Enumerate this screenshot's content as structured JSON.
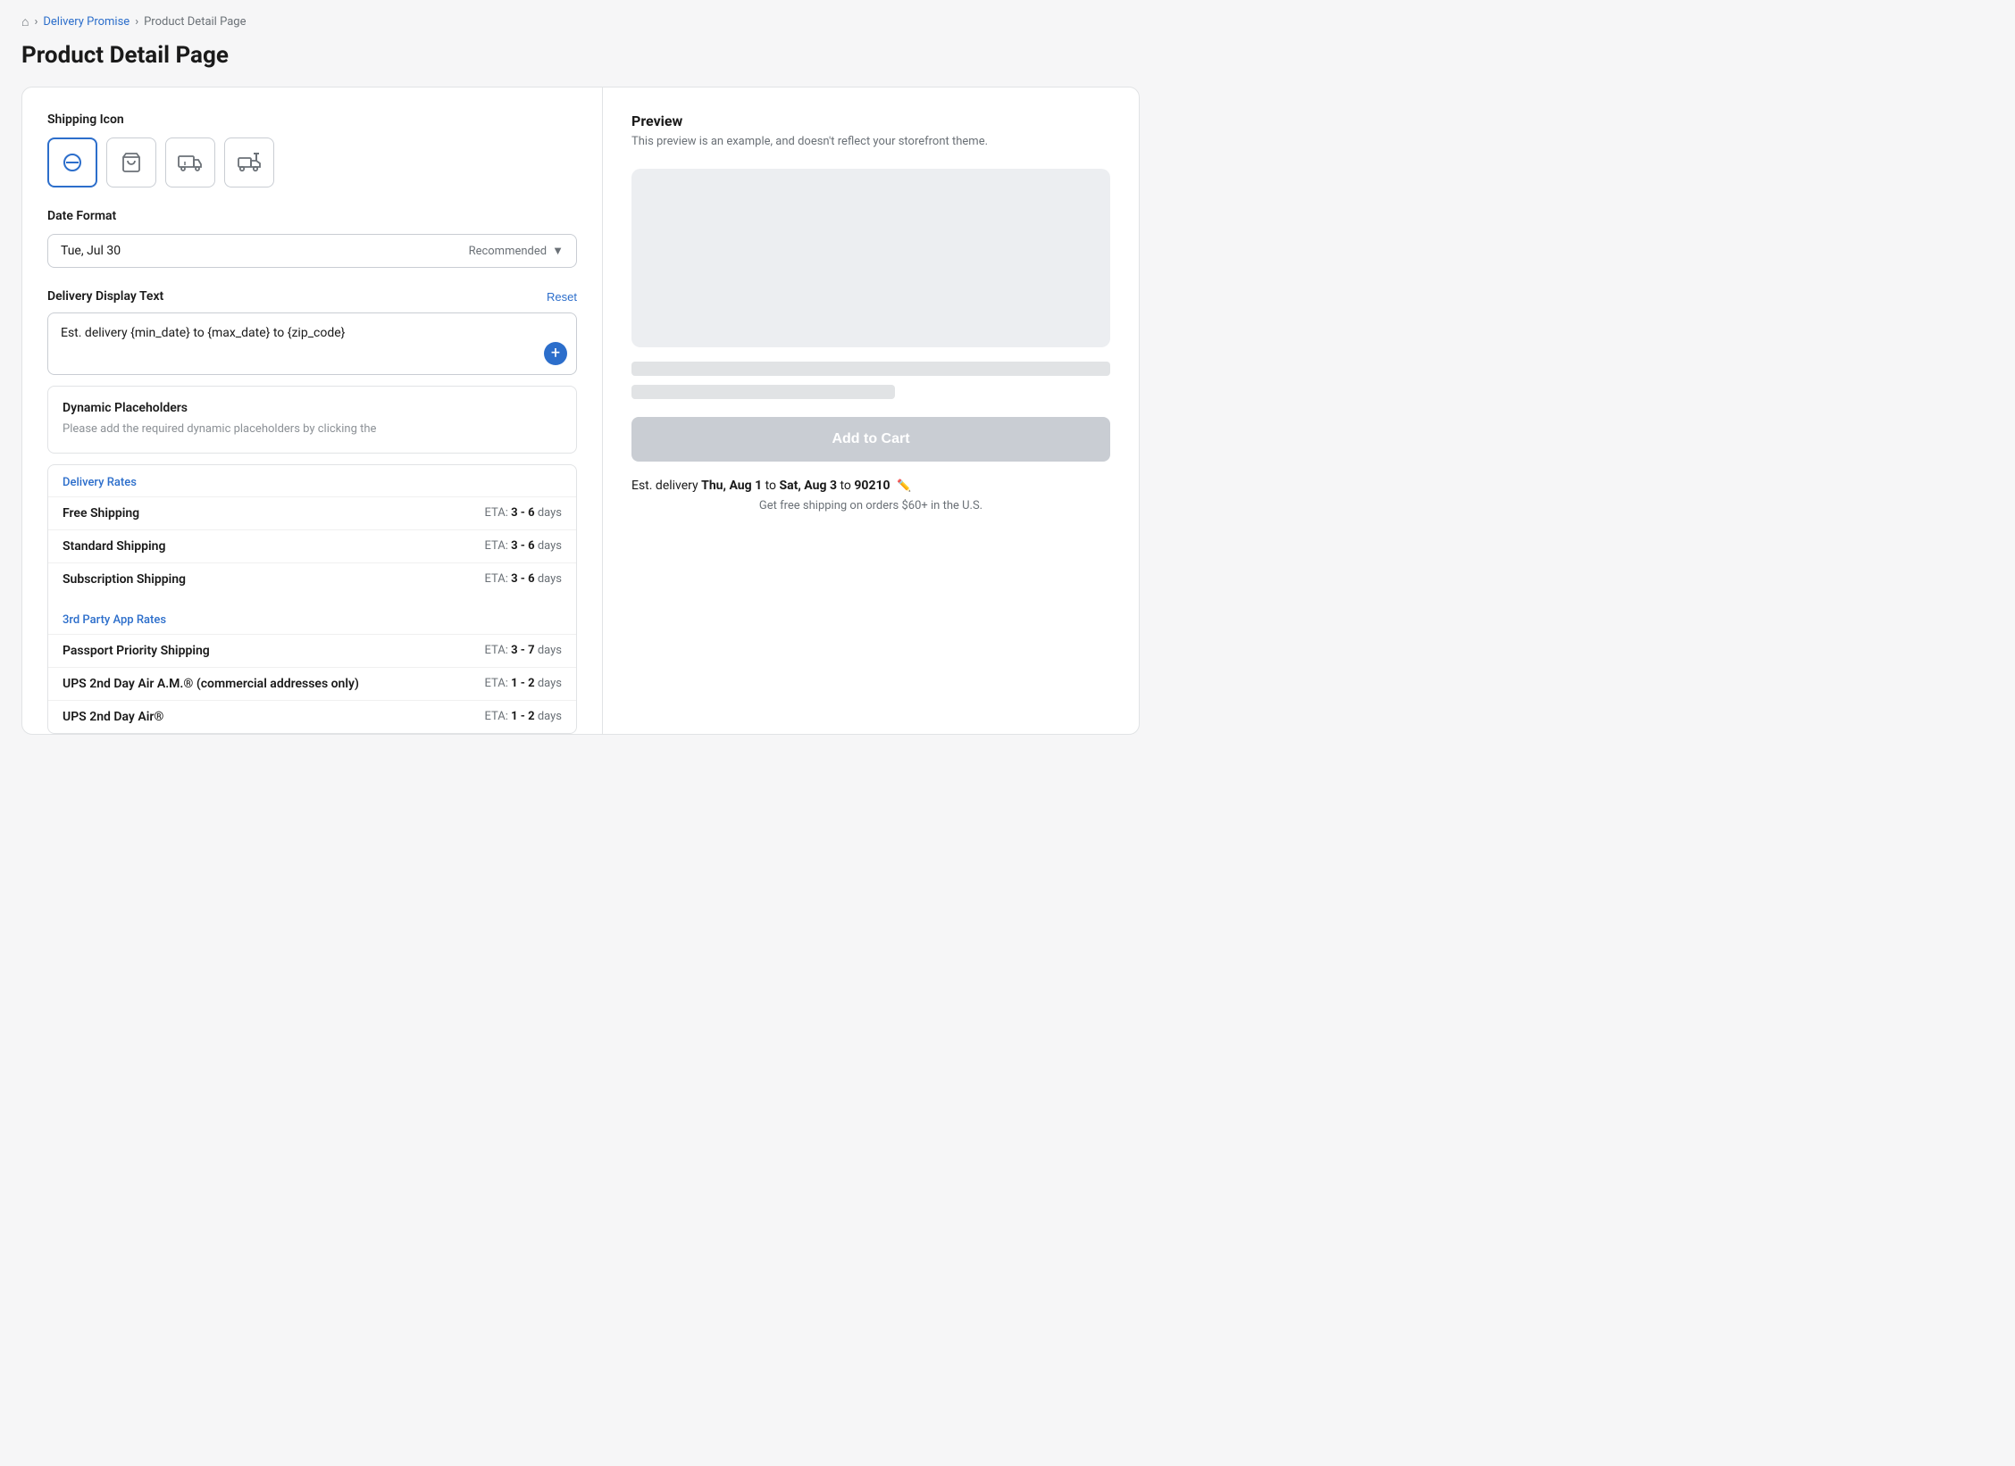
{
  "breadcrumb": {
    "home_icon": "🏠",
    "delivery_promise_label": "Delivery Promise",
    "current_page": "Product Detail Page"
  },
  "page_title": "Product Detail Page",
  "left_panel": {
    "shipping_icon_label": "Shipping Icon",
    "icons": [
      {
        "id": "no-shipping",
        "symbol": "⊘",
        "selected": true
      },
      {
        "id": "cart",
        "symbol": "🛒",
        "selected": false
      },
      {
        "id": "truck",
        "symbol": "🚛",
        "selected": false
      },
      {
        "id": "forklift",
        "symbol": "🚜",
        "selected": false
      }
    ],
    "date_format_label": "Date Format",
    "date_format_value": "Tue, Jul 30",
    "date_format_recommended": "Recommended",
    "delivery_display_label": "Delivery Display Text",
    "reset_label": "Reset",
    "delivery_text": "Est. delivery {min_date} to {max_date} to {zip_code}",
    "plus_icon": "+",
    "dynamic_placeholders_title": "Dynamic Placeholders",
    "dynamic_placeholders_desc": "Please add the required dynamic placeholders by clicking the",
    "delivery_rates": {
      "group1_label": "Delivery Rates",
      "rates1": [
        {
          "name": "Free Shipping",
          "eta_prefix": "ETA:",
          "eta_range": "3 - 6",
          "eta_unit": "days"
        },
        {
          "name": "Standard Shipping",
          "eta_prefix": "ETA:",
          "eta_range": "3 - 6",
          "eta_unit": "days"
        },
        {
          "name": "Subscription Shipping",
          "eta_prefix": "ETA:",
          "eta_range": "3 - 6",
          "eta_unit": "days"
        }
      ],
      "group2_label": "3rd Party App Rates",
      "rates2": [
        {
          "name": "Passport Priority Shipping",
          "eta_prefix": "ETA:",
          "eta_range": "3 - 7",
          "eta_unit": "days"
        },
        {
          "name": "UPS 2nd Day Air A.M.® (commercial addresses only)",
          "eta_prefix": "ETA:",
          "eta_range": "1 - 2",
          "eta_unit": "days"
        },
        {
          "name": "UPS 2nd Day Air®",
          "eta_prefix": "ETA:",
          "eta_range": "1 - 2",
          "eta_unit": "days"
        }
      ]
    }
  },
  "right_panel": {
    "preview_title": "Preview",
    "preview_desc": "This preview is an example, and doesn't reflect your storefront theme.",
    "add_to_cart_label": "Add to Cart",
    "est_delivery_prefix": "Est. delivery",
    "est_delivery_date1": "Thu, Aug 1",
    "est_delivery_to1": "to",
    "est_delivery_date2": "Sat, Aug 3",
    "est_delivery_to2": "to",
    "est_delivery_zip": "90210",
    "free_shipping_note": "Get free shipping on orders $60+ in the U.S."
  }
}
